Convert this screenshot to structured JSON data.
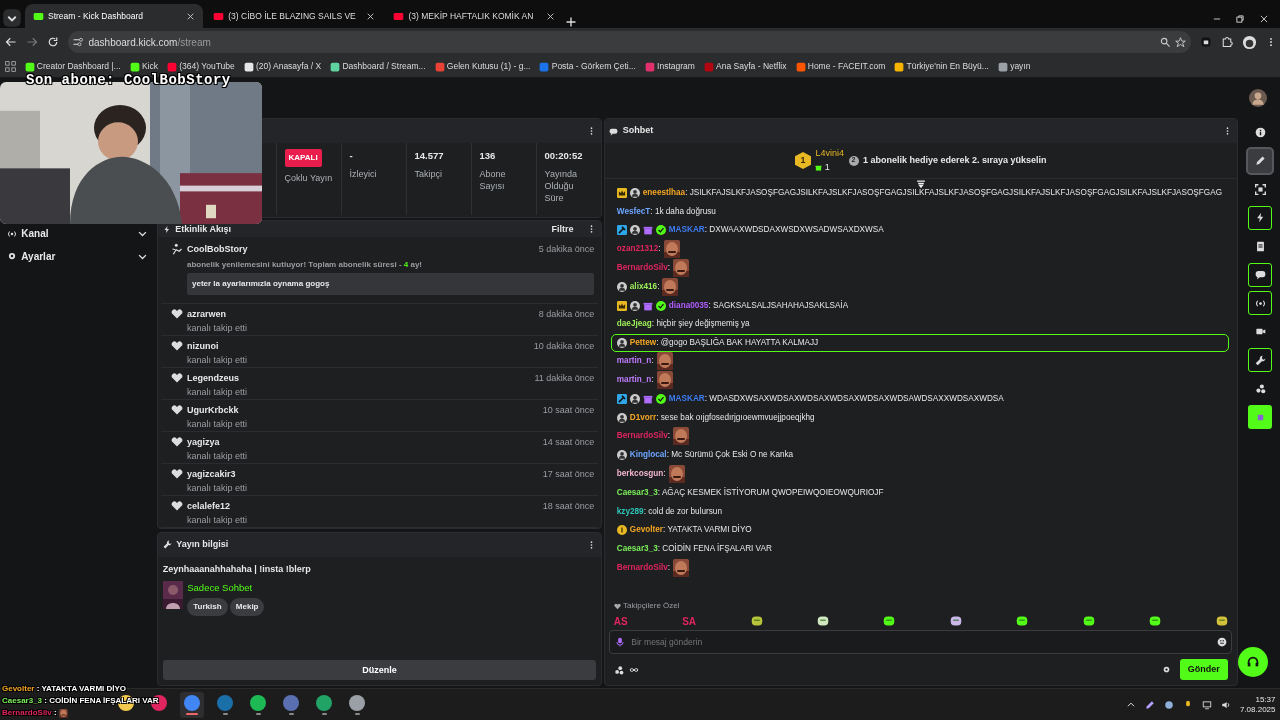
{
  "browser": {
    "tabs": [
      {
        "title": "Stream - Kick Dashboard",
        "selected": true,
        "color": "#53fc18"
      },
      {
        "title": "(3) CİBO İLE BLAZING SAILS VE",
        "selected": false,
        "color": "#ff0033"
      },
      {
        "title": "(3) MEKİP HAFTALIK KOMİK AN",
        "selected": false,
        "color": "#ff0033"
      }
    ],
    "address": {
      "host": "dashboard.kick.com",
      "path": "/stream"
    },
    "bookmarks": [
      {
        "label": "Creator Dashboard |...",
        "color": "#53fc18"
      },
      {
        "label": "Kick",
        "color": "#53fc18"
      },
      {
        "label": "(364) YouTube",
        "color": "#ff0033"
      },
      {
        "label": "(20) Anasayfa / X",
        "color": "#e6e6e6"
      },
      {
        "label": "Dashboard / Stream...",
        "color": "#5fd3a0"
      },
      {
        "label": "Gelen Kutusu (1) - g...",
        "color": "#ea4335"
      },
      {
        "label": "Posta - Görkem Çeti...",
        "color": "#1a73e8"
      },
      {
        "label": "Instagram",
        "color": "#e1306c"
      },
      {
        "label": "Ana Sayfa - Netflix",
        "color": "#b20710"
      },
      {
        "label": "Home - FACEIT.com",
        "color": "#ff5500"
      },
      {
        "label": "Türkiye'nin En Büyü...",
        "color": "#f4b400"
      },
      {
        "label": "yayın",
        "color": "#9aa0a6"
      }
    ]
  },
  "overlay": {
    "last_subscriber": "Son abone: CoolBobStory",
    "chat": [
      {
        "user": "Gevolter",
        "color": "#f5a623",
        "text": ": YATAKTA VARMI DİYO",
        "kind": "text"
      },
      {
        "user": "Caesar3_3",
        "color": "#7cf05a",
        "text": ": COİDİN FENA İFŞALARI VAR",
        "kind": "text"
      },
      {
        "user": "BernardoSilv",
        "color": "#e0245e",
        "text": ":",
        "kind": "emote"
      }
    ]
  },
  "sidebar": {
    "items": [
      {
        "label": "Kanal",
        "kind": "channel"
      },
      {
        "label": "Ayarlar",
        "kind": "settings"
      }
    ]
  },
  "stats": [
    {
      "value": "KAPALI",
      "label": "Çoklu Yayın",
      "kind": "badge"
    },
    {
      "value": "-",
      "label": "İzleyici",
      "kind": "number"
    },
    {
      "value": "14.577",
      "label": "Takipçi",
      "kind": "number"
    },
    {
      "value": "136",
      "label": "Abone Sayısı",
      "kind": "number"
    },
    {
      "value": "00:20:52",
      "label": "Yayında Olduğu Süre",
      "kind": "number"
    }
  ],
  "events": {
    "title": "Etkinlik Akışı",
    "filter": "Filtre",
    "items": [
      {
        "kind": "subscription",
        "user": "CoolBobStory",
        "time": "5 dakika önce",
        "text_before": "abonelik yenilemesini kutluyor! Toplam abonelik süresi -",
        "months": "4",
        "text_after": "ay!",
        "message": "yeter la ayarlarımızla oynama gogoş"
      },
      {
        "kind": "follow",
        "user": "azrarwen",
        "time": "8 dakika önce",
        "action": "kanalı takip etti"
      },
      {
        "kind": "follow",
        "user": "nizunoi",
        "time": "10 dakika önce",
        "action": "kanalı takip etti"
      },
      {
        "kind": "follow",
        "user": "Legendzeus",
        "time": "11 dakika önce",
        "action": "kanalı takip etti"
      },
      {
        "kind": "follow",
        "user": "UgurKrbckk",
        "time": "10 saat önce",
        "action": "kanalı takip etti"
      },
      {
        "kind": "follow",
        "user": "yagizya",
        "time": "14 saat önce",
        "action": "kanalı takip etti"
      },
      {
        "kind": "follow",
        "user": "yagizcakir3",
        "time": "17 saat önce",
        "action": "kanalı takip etti"
      },
      {
        "kind": "follow",
        "user": "celalefe12",
        "time": "18 saat önce",
        "action": "kanalı takip etti"
      }
    ]
  },
  "stream_info": {
    "title": "Yayın bilgisi",
    "stream_title": "Zeynhaaanahhahaha | !insta !blerp",
    "category": "Sadece Sohbet",
    "tags": [
      "Turkish",
      "Mekip"
    ],
    "edit_button": "Düzenle"
  },
  "chat": {
    "title": "Sohbet",
    "leader": {
      "rank": "1",
      "user": "L4vini4",
      "gifts": "1",
      "next_rank": "2",
      "prompt": "1 abonelik hediye ederek 2. sıraya yükselin"
    },
    "messages": [
      {
        "user": "eneestlhaa",
        "color": "#f5a623",
        "badges": [
          {
            "kind": "crown"
          },
          {
            "kind": "avatar"
          }
        ],
        "kind": "text",
        "text": ": JSILKFAJSLKFJASOŞFGAGJSILKFAJSLKFJASOŞFGAGJSILKFAJSLKFJASOŞFGAGJSILKFAJSLKFJASOŞFGAGJSILKFAJSLKFJASOŞFGAG",
        "highlighted": false
      },
      {
        "user": "WesfecT",
        "color": "#6ea6ff",
        "kind": "text",
        "text": ": 1k daha doğrusu",
        "highlighted": false
      },
      {
        "user": "MASKAR",
        "color": "#3d7bf0",
        "badges": [
          {
            "kind": "hammer"
          },
          {
            "kind": "avatar"
          },
          {
            "kind": "gift"
          },
          {
            "kind": "verified"
          }
        ],
        "kind": "text",
        "text": ": DXWAAXWDSDAXWSDXWSADWSAXDXWSA",
        "highlighted": false
      },
      {
        "user": "ozan21312",
        "color": "#e0245e",
        "kind": "emote",
        "text": ":",
        "highlighted": false
      },
      {
        "user": "BernardoSilv",
        "color": "#e0245e",
        "kind": "emote",
        "text": ":",
        "highlighted": false
      },
      {
        "user": "alix416",
        "color": "#9ef05a",
        "badges": [
          {
            "kind": "avatar"
          }
        ],
        "kind": "emote",
        "text": ":",
        "highlighted": false
      },
      {
        "user": "diana0035",
        "color": "#b05cff",
        "badges": [
          {
            "kind": "crown"
          },
          {
            "kind": "avatar"
          },
          {
            "kind": "gift"
          },
          {
            "kind": "verified"
          }
        ],
        "kind": "text",
        "text": ": SAGKSALSALJSAHAHAJSAKLSAİA",
        "highlighted": false
      },
      {
        "user": "daeJjeag",
        "color": "#9ef05a",
        "kind": "text",
        "text": ": hiçbir şiey değişmemiş ya",
        "highlighted": false
      },
      {
        "user": "Pettew",
        "color": "#f5a623",
        "badges": [
          {
            "kind": "avatar"
          }
        ],
        "kind": "text",
        "text": ": @gogo BAŞLIĞA BAK HAYATTA KALMAJJ",
        "highlighted": true
      },
      {
        "user": "martin_n",
        "color": "#c07cff",
        "kind": "emote",
        "text": ":",
        "highlighted": false
      },
      {
        "user": "martin_n",
        "color": "#c07cff",
        "kind": "emote",
        "text": ":",
        "highlighted": false
      },
      {
        "user": "MASKAR",
        "color": "#3d7bf0",
        "badges": [
          {
            "kind": "hammer"
          },
          {
            "kind": "avatar"
          },
          {
            "kind": "gift"
          },
          {
            "kind": "verified"
          }
        ],
        "kind": "text",
        "text": ": WDASDXWSAXWDSAXWDSAXWDSAXWDSAXWDSAWDSAXXWDSAXWDSA",
        "highlighted": false
      },
      {
        "user": "D1vorr",
        "color": "#f5a623",
        "badges": [
          {
            "kind": "avatar"
          }
        ],
        "kind": "text",
        "text": ": sese bak oıjgfosedırjgıoewmvuejjpoeqjkhg",
        "highlighted": false
      },
      {
        "user": "BernardoSilv",
        "color": "#e0245e",
        "kind": "emote",
        "text": ":",
        "highlighted": false
      },
      {
        "user": "Kinglocal",
        "color": "#6ea6ff",
        "badges": [
          {
            "kind": "avatar"
          }
        ],
        "kind": "text",
        "text": ": Mc Sürümü Çok Eski O ne Kanka",
        "highlighted": false
      },
      {
        "user": "berkcosgun",
        "color": "#f3b6d0",
        "kind": "emote",
        "text": ":",
        "highlighted": false
      },
      {
        "user": "Caesar3_3",
        "color": "#7cf05a",
        "kind": "text",
        "text": ": AĞAÇ KESMEK İSTİYORUM QWOPEIWQOIEOWQURIOJF",
        "highlighted": false
      },
      {
        "user": "kzy289",
        "color": "#2ec4b6",
        "kind": "text",
        "text": ": cold de zor bulursun",
        "highlighted": false
      },
      {
        "user": "Gevolter",
        "color": "#f5a623",
        "badges": [
          {
            "kind": "rank"
          }
        ],
        "kind": "text",
        "text": ": YATAKTA VARMI DİYO",
        "highlighted": false
      },
      {
        "user": "Caesar3_3",
        "color": "#7cf05a",
        "kind": "text",
        "text": ": COİDİN FENA İFŞALARI VAR",
        "highlighted": false
      },
      {
        "user": "BernardoSilv",
        "color": "#e0245e",
        "kind": "emote",
        "text": ":",
        "highlighted": false
      }
    ],
    "emote_label": "Takipçilere Özel",
    "emotes": [
      {
        "kind": "text",
        "text": "AS"
      },
      {
        "kind": "text",
        "text": "SA"
      },
      {
        "kind": "icon",
        "color": "#b8c43a"
      },
      {
        "kind": "icon",
        "color": "#cfe8c0"
      },
      {
        "kind": "icon",
        "color": "#53fc18"
      },
      {
        "kind": "icon",
        "color": "#c9b8e8"
      },
      {
        "kind": "icon",
        "color": "#53fc18"
      },
      {
        "kind": "icon",
        "color": "#53fc18"
      },
      {
        "kind": "icon",
        "color": "#53fc18"
      },
      {
        "kind": "icon",
        "color": "#d4c23a"
      }
    ],
    "placeholder": "Bir mesaj gönderin",
    "send_button": "Gönder"
  },
  "rail": [
    {
      "kind": "info",
      "selected": false,
      "on": false
    },
    {
      "kind": "pencil",
      "selected": true,
      "on": false
    },
    {
      "kind": "scan",
      "selected": false,
      "on": false
    },
    {
      "kind": "bolt",
      "selected": false,
      "on": true
    },
    {
      "kind": "doc",
      "selected": false,
      "on": false
    },
    {
      "kind": "chat",
      "selected": false,
      "on": true
    },
    {
      "kind": "broadcast",
      "selected": false,
      "on": true
    },
    {
      "kind": "camera",
      "selected": false,
      "on": false
    },
    {
      "kind": "wrench",
      "selected": false,
      "on": true
    },
    {
      "kind": "dots",
      "selected": false,
      "on": false
    },
    {
      "kind": "app",
      "selected": false,
      "on": false
    }
  ],
  "taskbar": {
    "apps": [
      {
        "color": "#f2c94c",
        "running": false,
        "selected": false
      },
      {
        "color": "#e0245e",
        "running": false,
        "selected": false
      },
      {
        "color": "#4285f4",
        "running": true,
        "selected": true
      },
      {
        "color": "#1b6fa8",
        "running": true,
        "selected": false
      },
      {
        "color": "#1db954",
        "running": true,
        "selected": false
      },
      {
        "color": "#5a6fb0",
        "running": true,
        "selected": false
      },
      {
        "color": "#21a366",
        "running": true,
        "selected": false
      },
      {
        "color": "#9aa0a6",
        "running": true,
        "selected": false
      }
    ],
    "time": "15:37",
    "date": "7.08.2025"
  }
}
